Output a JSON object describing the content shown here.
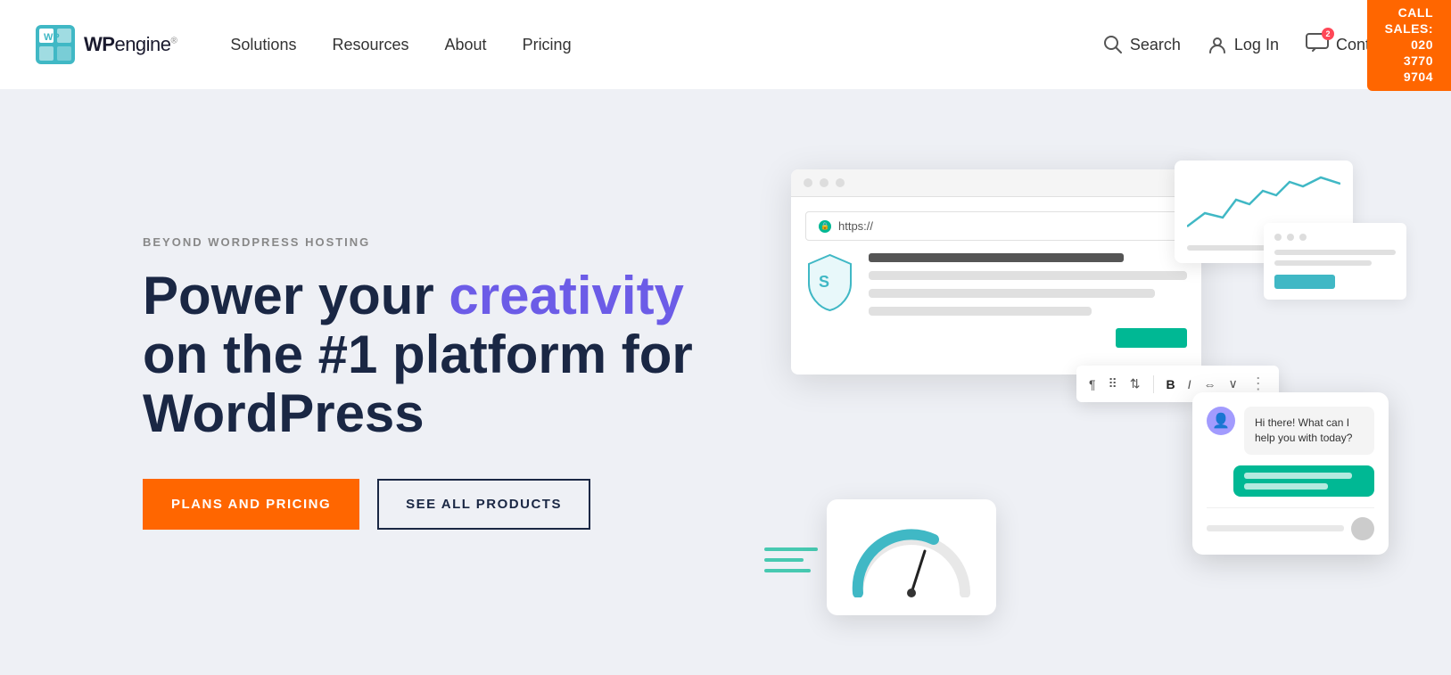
{
  "topbar": {
    "cta_label": "CALL SALES: 020 3770 9704"
  },
  "header": {
    "logo_wp": "WP",
    "logo_engine": "engine",
    "logo_sup": "®",
    "nav": [
      {
        "id": "solutions",
        "label": "Solutions"
      },
      {
        "id": "resources",
        "label": "Resources"
      },
      {
        "id": "about",
        "label": "About"
      },
      {
        "id": "pricing",
        "label": "Pricing"
      }
    ],
    "search_label": "Search",
    "login_label": "Log In",
    "contact_label": "Contact Us"
  },
  "hero": {
    "eyebrow": "BEYOND WORDPRESS HOSTING",
    "title_part1": "Power your ",
    "title_highlight": "creativity",
    "title_part2": "on the #1 platform for WordPress",
    "btn_primary": "PLANS AND PRICING",
    "btn_secondary": "SEE ALL PRODUCTS"
  },
  "illustration": {
    "address": "https://",
    "chat_message": "Hi there! What can I help you with today?",
    "chat_reply_lines": 2
  }
}
